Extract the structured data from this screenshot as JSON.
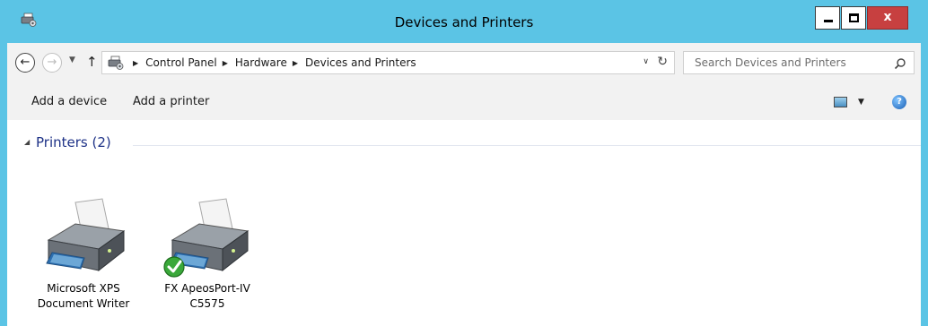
{
  "window": {
    "title": "Devices and Printers",
    "close_glyph": "x",
    "app_icon": "devices-and-printers-icon"
  },
  "nav": {
    "back_icon": "back-arrow-icon",
    "forward_icon": "forward-arrow-icon",
    "up_icon": "up-arrow-icon"
  },
  "address": {
    "breadcrumbs": [
      "Control Panel",
      "Hardware",
      "Devices and Printers"
    ]
  },
  "search": {
    "placeholder": "Search Devices and Printers"
  },
  "commands": {
    "add_device": "Add a device",
    "add_printer": "Add a printer"
  },
  "group": {
    "title": "Printers (2)"
  },
  "devices": [
    {
      "label": "Microsoft XPS\nDocument Writer",
      "default": false
    },
    {
      "label": "FX ApeosPort-IV\nC5575",
      "default": true
    }
  ],
  "colors": {
    "titlebar": "#5bc4e5",
    "close_button": "#c74040",
    "group_title": "#1e3287",
    "default_check": "#3aa83a"
  }
}
